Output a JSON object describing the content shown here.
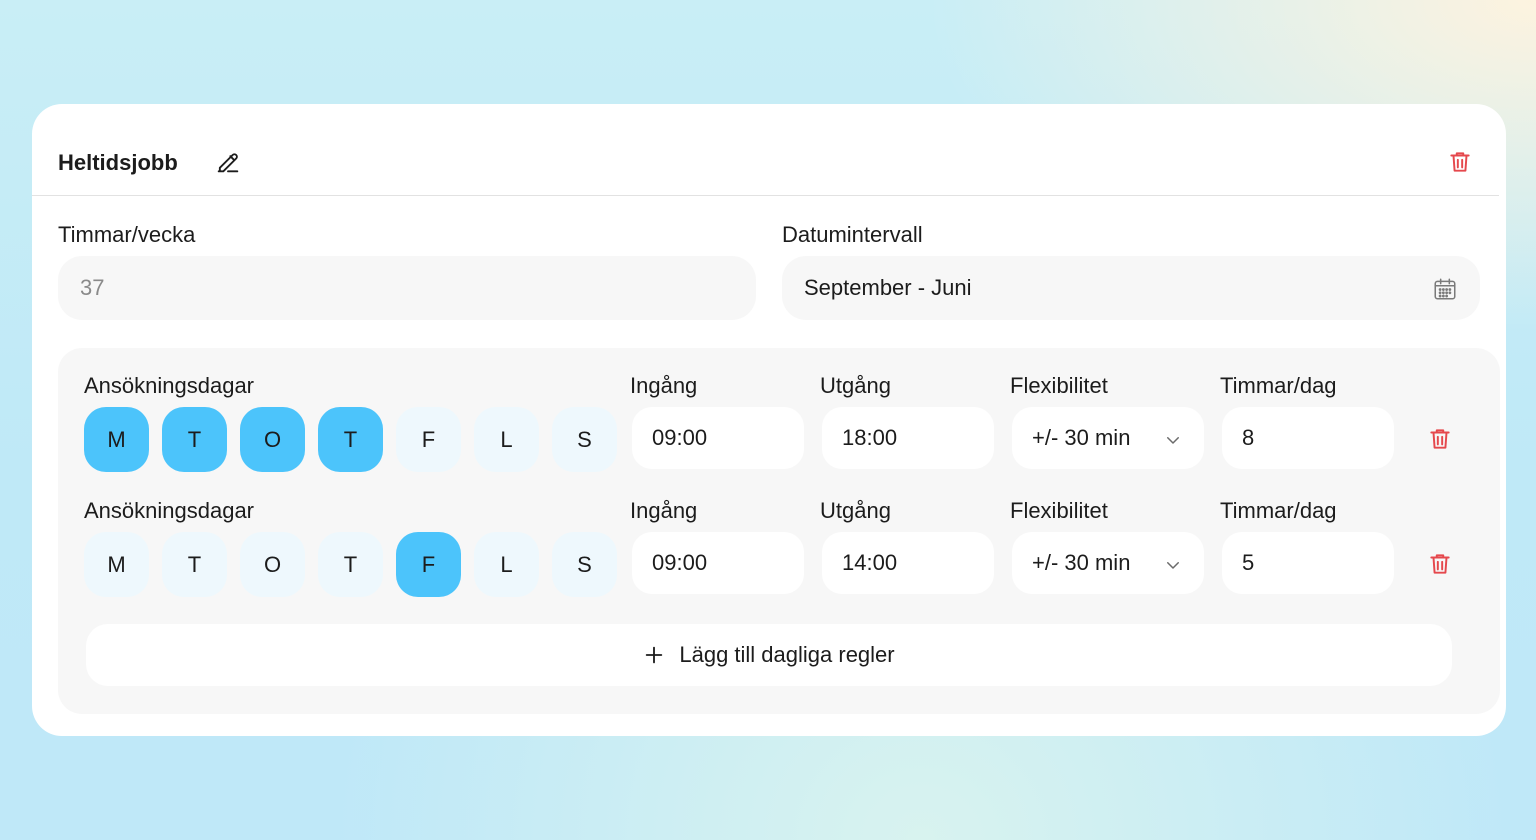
{
  "card": {
    "title": "Heltidsjobb",
    "hours_week_label": "Timmar/vecka",
    "hours_week_value": "37",
    "date_range_label": "Datumintervall",
    "date_range_value": "September - Juni"
  },
  "colors": {
    "accent": "#4cc4fb",
    "day_inactive": "#eef8fd",
    "delete": "#e5484d"
  },
  "icons": {
    "edit": "edit-icon",
    "delete": "trash-icon",
    "calendar": "calendar-icon",
    "dropdown": "chevron-down-icon",
    "add": "plus-icon"
  },
  "rules": [
    {
      "days_label": "Ansökningsdagar",
      "days": [
        {
          "label": "M",
          "active": true
        },
        {
          "label": "T",
          "active": true
        },
        {
          "label": "O",
          "active": true
        },
        {
          "label": "T",
          "active": true
        },
        {
          "label": "F",
          "active": false
        },
        {
          "label": "L",
          "active": false
        },
        {
          "label": "S",
          "active": false
        }
      ],
      "in_label": "Ingång",
      "in_value": "09:00",
      "out_label": "Utgång",
      "out_value": "18:00",
      "flex_label": "Flexibilitet",
      "flex_value": "+/- 30 min",
      "hours_label": "Timmar/dag",
      "hours_value": "8"
    },
    {
      "days_label": "Ansökningsdagar",
      "days": [
        {
          "label": "M",
          "active": false
        },
        {
          "label": "T",
          "active": false
        },
        {
          "label": "O",
          "active": false
        },
        {
          "label": "T",
          "active": false
        },
        {
          "label": "F",
          "active": true
        },
        {
          "label": "L",
          "active": false
        },
        {
          "label": "S",
          "active": false
        }
      ],
      "in_label": "Ingång",
      "in_value": "09:00",
      "out_label": "Utgång",
      "out_value": "14:00",
      "flex_label": "Flexibilitet",
      "flex_value": "+/- 30 min",
      "hours_label": "Timmar/dag",
      "hours_value": "5"
    }
  ],
  "add_rule_label": "Lägg till dagliga regler"
}
